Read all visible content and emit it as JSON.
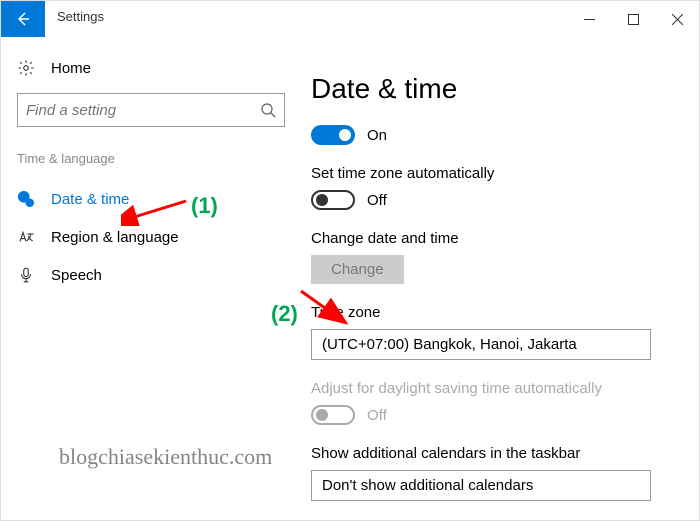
{
  "window": {
    "title": "Settings"
  },
  "sidebar": {
    "home": "Home",
    "search_placeholder": "Find a setting",
    "section": "Time & language",
    "items": [
      {
        "label": "Date & time"
      },
      {
        "label": "Region & language"
      },
      {
        "label": "Speech"
      }
    ]
  },
  "main": {
    "title": "Date & time",
    "auto_time_state": "On",
    "auto_tz_label": "Set time zone automatically",
    "auto_tz_state": "Off",
    "change_label": "Change date and time",
    "change_btn": "Change",
    "tz_label": "Time zone",
    "tz_value": "(UTC+07:00) Bangkok, Hanoi, Jakarta",
    "dst_label": "Adjust for daylight saving time automatically",
    "dst_state": "Off",
    "calendars_label": "Show additional calendars in the taskbar",
    "calendars_value": "Don't show additional calendars"
  },
  "annotations": {
    "one": "(1)",
    "two": "(2)",
    "watermark": "blogchiasekienthuc.com"
  }
}
